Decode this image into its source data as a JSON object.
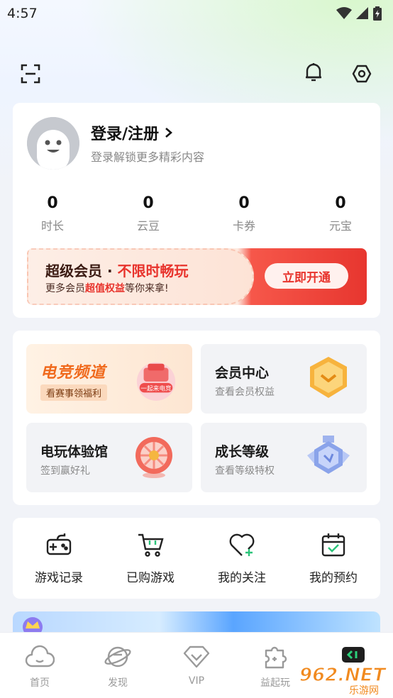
{
  "status_bar": {
    "time": "4:57"
  },
  "profile": {
    "login_title": "登录/注册",
    "login_subtitle": "登录解锁更多精彩内容",
    "stats": [
      {
        "value": "0",
        "label": "时长"
      },
      {
        "value": "0",
        "label": "云豆"
      },
      {
        "value": "0",
        "label": "卡券"
      },
      {
        "value": "0",
        "label": "元宝"
      }
    ]
  },
  "vip_banner": {
    "title_part1": "超级会员 · ",
    "title_part2": "不限时畅玩",
    "sub_part1": "更多会员",
    "sub_part2": "超值权益",
    "sub_part3": "等你来拿!",
    "button": "立即开通"
  },
  "features": {
    "esports": {
      "title": "电竞频道",
      "subtitle": "看赛事领福利",
      "art_text": "一起来电竞"
    },
    "member_center": {
      "title": "会员中心",
      "subtitle": "查看会员权益"
    },
    "arcade": {
      "title": "电玩体验馆",
      "subtitle": "签到赢好礼"
    },
    "growth": {
      "title": "成长等级",
      "subtitle": "查看等级特权"
    }
  },
  "quick_actions": [
    {
      "label": "游戏记录",
      "icon": "gamepad-icon"
    },
    {
      "label": "已购游戏",
      "icon": "cart-icon"
    },
    {
      "label": "我的关注",
      "icon": "heart-plus-icon"
    },
    {
      "label": "我的预约",
      "icon": "calendar-check-icon"
    }
  ],
  "tabs": [
    {
      "label": "首页",
      "icon": "cloud-icon"
    },
    {
      "label": "发现",
      "icon": "planet-icon"
    },
    {
      "label": "VIP",
      "icon": "diamond-icon"
    },
    {
      "label": "益起玩",
      "icon": "puzzle-icon"
    }
  ],
  "watermark": {
    "text": "962.NET",
    "sub": "乐游网"
  },
  "colors": {
    "accent_red": "#e8332c",
    "esports_orange": "#f06a1d",
    "tab_gray": "#9a9a9a"
  }
}
